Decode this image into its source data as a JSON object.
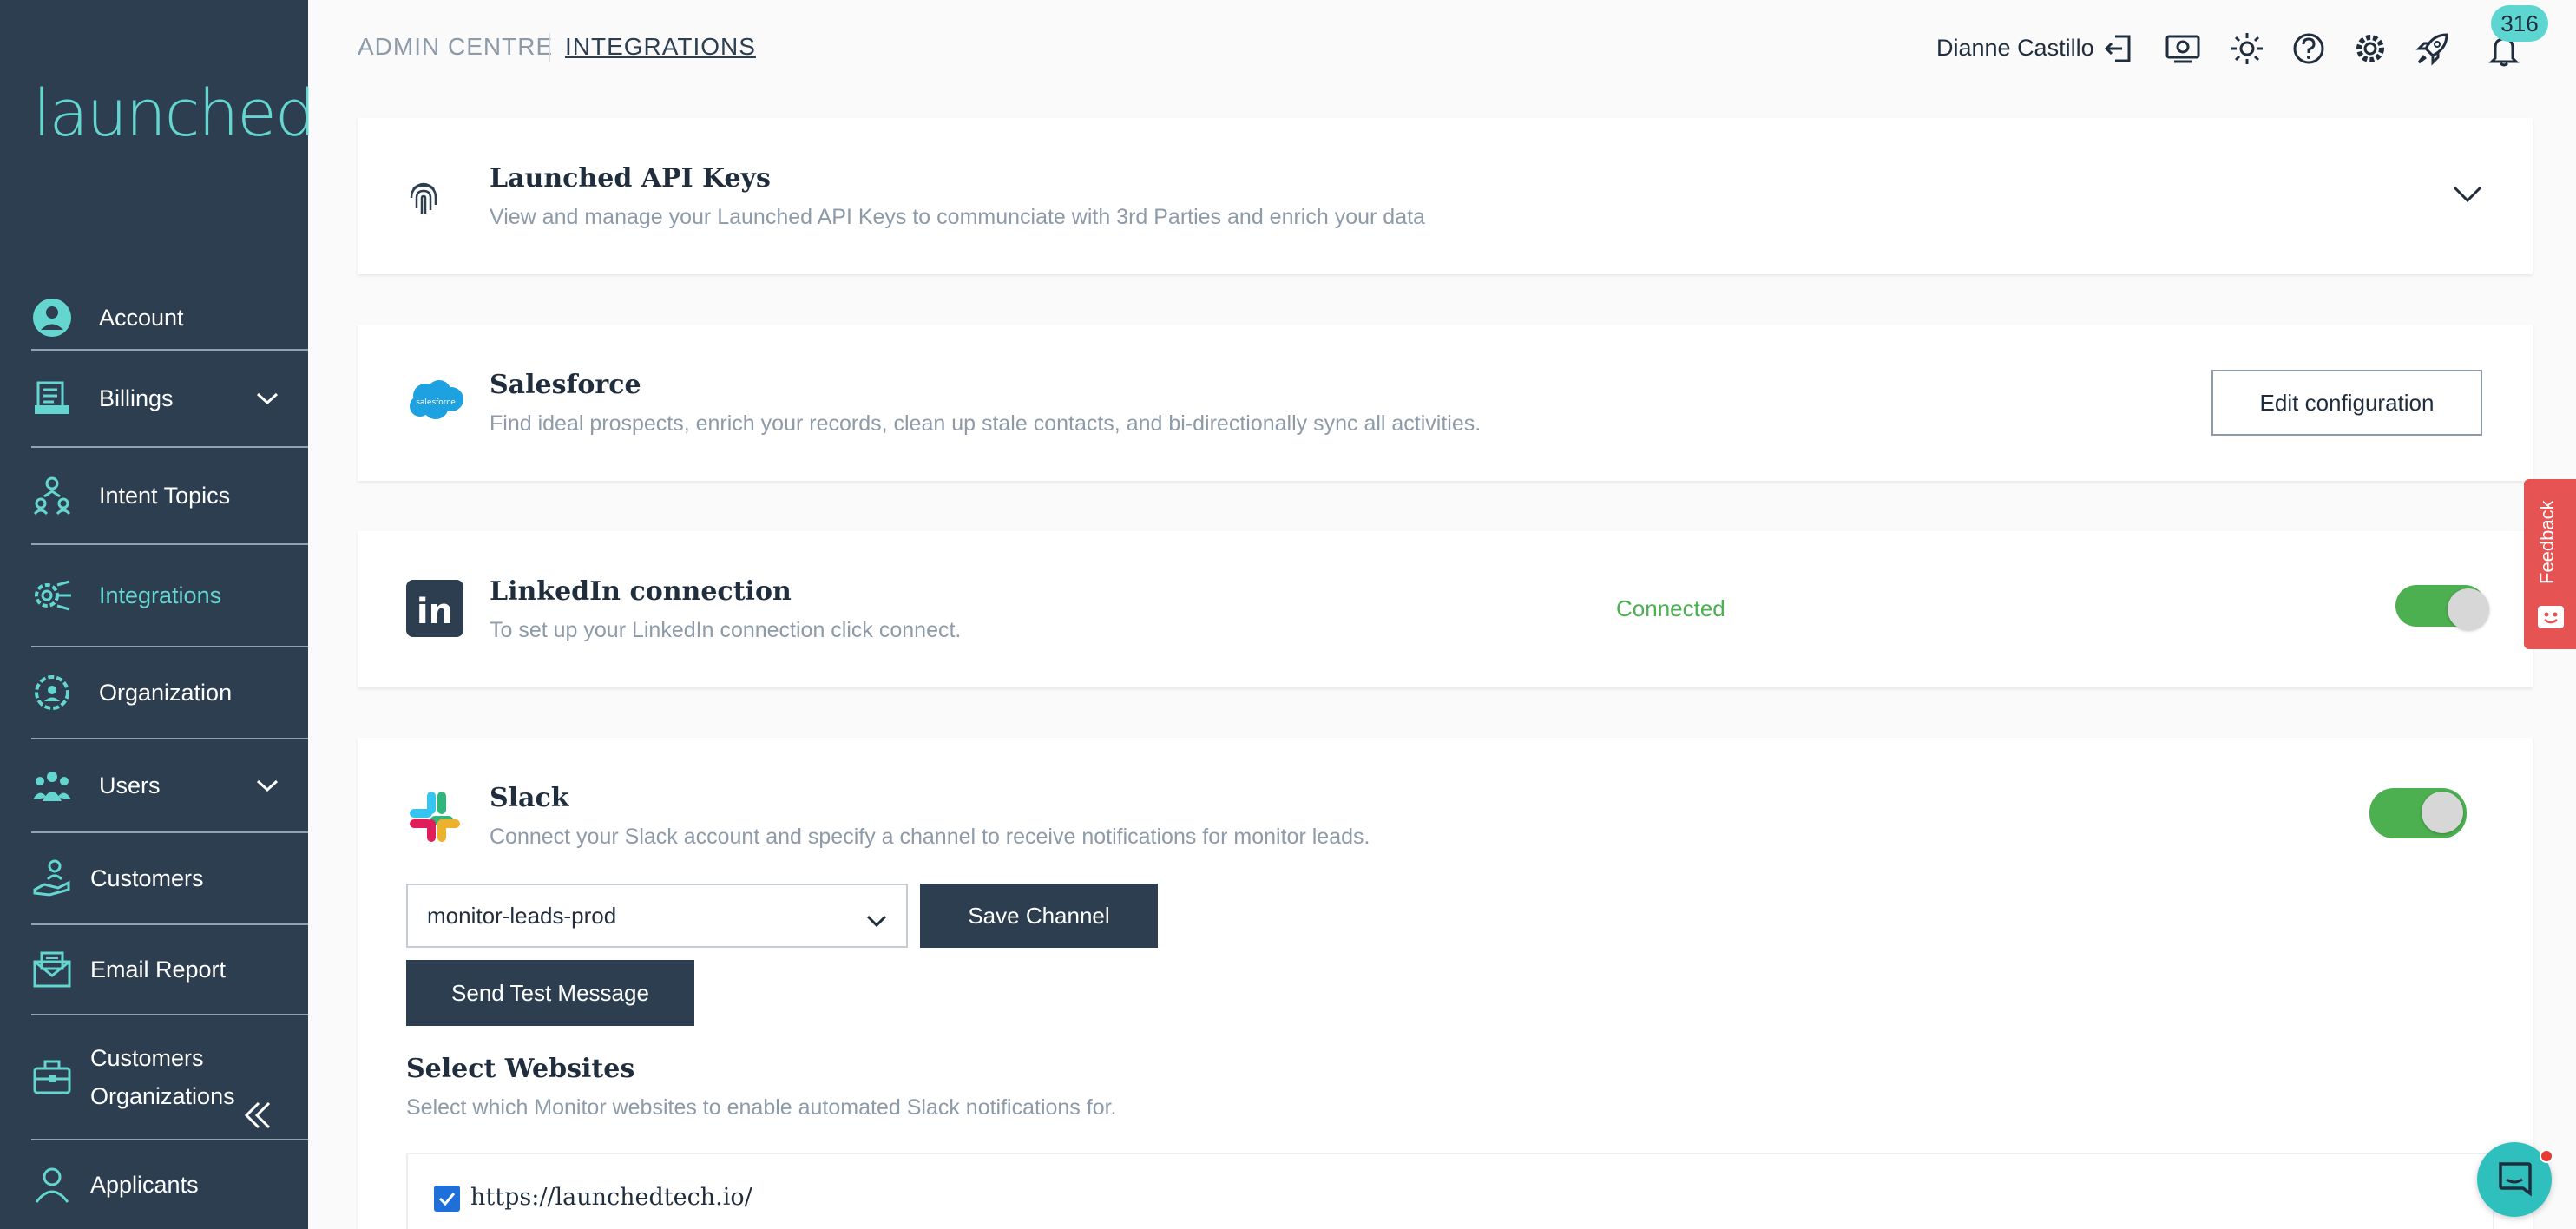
{
  "app": {
    "logo_text": "launched"
  },
  "sidebar": {
    "items": [
      {
        "label": "Account",
        "icon": "user-circle-icon"
      },
      {
        "label": "Billings",
        "icon": "receipt-icon"
      },
      {
        "label": "Intent Topics",
        "icon": "people-network-icon"
      },
      {
        "label": "Integrations",
        "icon": "gear-connections-icon"
      },
      {
        "label": "Organization",
        "icon": "gear-people-icon"
      },
      {
        "label": "Users",
        "icon": "users-group-icon"
      },
      {
        "label": "Customers",
        "icon": "hand-person-icon"
      },
      {
        "label": "Email Report",
        "icon": "envelope-icon"
      },
      {
        "label": "Customers Organizations",
        "icon": "briefcase-icon"
      },
      {
        "label": "Applicants",
        "icon": "person-outline-icon"
      }
    ],
    "active": "Integrations"
  },
  "header": {
    "breadcrumb_root": "ADMIN CENTRE",
    "breadcrumb_current": "INTEGRATIONS",
    "user_name": "Dianne Castillo",
    "notification_count": "316"
  },
  "cards": {
    "api_keys": {
      "title": "Launched API Keys",
      "description": "View and manage your Launched API Keys to communciate with 3rd Parties and enrich your data"
    },
    "salesforce": {
      "title": "Salesforce",
      "description": "Find ideal prospects, enrich your records, clean up stale contacts, and bi-directionally sync all activities.",
      "button": "Edit configuration",
      "logo_text": "salesforce"
    },
    "linkedin": {
      "title": "LinkedIn connection",
      "description": "To set up your LinkedIn connection click connect.",
      "status": "Connected",
      "logo_text": "in"
    },
    "slack": {
      "title": "Slack",
      "description": "Connect your Slack account and specify a channel to receive notifications for monitor leads.",
      "channel_value": "monitor-leads-prod",
      "save_button": "Save Channel",
      "test_button": "Send Test Message",
      "websites_title": "Select Websites",
      "websites_desc": "Select which Monitor websites to enable automated Slack notifications for.",
      "websites": [
        "https://launchedtech.io/"
      ]
    }
  },
  "feedback": {
    "label": "Feedback"
  },
  "colors": {
    "sidebar_bg": "#2c3e50",
    "accent": "#64d6cf",
    "success": "#4caf50",
    "feedback": "#e55353"
  }
}
